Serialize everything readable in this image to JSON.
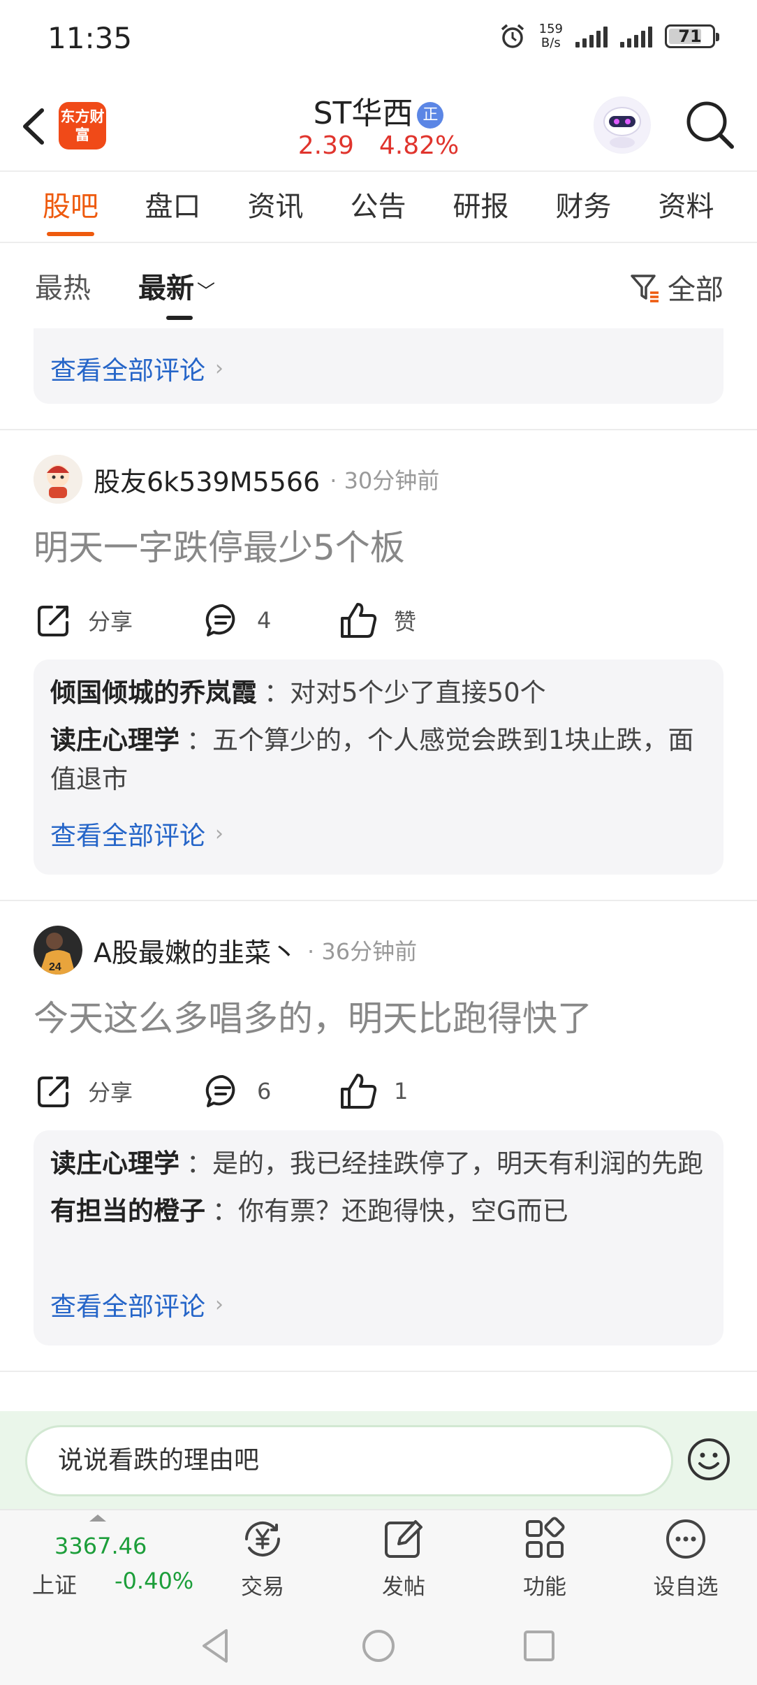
{
  "status_bar": {
    "time": "11:35",
    "net_speed_value": "159",
    "net_speed_unit": "B/s",
    "battery": "71"
  },
  "header": {
    "logo_text": "东方财富",
    "stock_name": "ST华西",
    "badge": "正",
    "price": "2.39",
    "change": "4.82%"
  },
  "tabs": [
    {
      "label": "股吧",
      "active": true
    },
    {
      "label": "盘口"
    },
    {
      "label": "资讯"
    },
    {
      "label": "公告"
    },
    {
      "label": "研报"
    },
    {
      "label": "财务"
    },
    {
      "label": "资料"
    }
  ],
  "sort": {
    "hot": "最热",
    "new": "最新",
    "filter": "全部"
  },
  "view_all_label": "查看全部评论",
  "posts": [
    {
      "username": "股友6k539M5566",
      "time": "· 30分钟前",
      "content": "明天一字跌停最少5个板",
      "share_label": "分享",
      "comments": "4",
      "likes": "赞",
      "replies": [
        {
          "user": "倾国倾城的乔岚霞",
          "text": "：对对5个少了直接50个"
        },
        {
          "user": "读庄心理学",
          "text": "：五个算少的，个人感觉会跌到1块止跌，面值退市"
        }
      ]
    },
    {
      "username": "A股最嫩的韭菜丶",
      "time": "· 36分钟前",
      "content": "今天这么多唱多的，明天比跑得快了",
      "share_label": "分享",
      "comments": "6",
      "likes": "1",
      "replies": [
        {
          "user": "读庄心理学",
          "text": "：是的，我已经挂跌停了，明天有利润的先跑"
        },
        {
          "user": "有担当的橙子",
          "text": "：你有票？还跑得快，空G而已"
        }
      ]
    }
  ],
  "input": {
    "placeholder": "说说看跌的理由吧"
  },
  "bottom_nav": {
    "index": {
      "value": "3367.46",
      "name": "上证",
      "change": "-0.40%"
    },
    "items": [
      {
        "label": "交易",
        "icon": "yuan-exchange-icon"
      },
      {
        "label": "发帖",
        "icon": "edit-post-icon"
      },
      {
        "label": "功能",
        "icon": "grid-apps-icon"
      },
      {
        "label": "设自选",
        "icon": "more-dots-icon"
      }
    ]
  },
  "colors": {
    "accent": "#ee5a0e",
    "price_up": "#e0342d",
    "price_down": "#1c9e3a",
    "link": "#2565c8"
  }
}
